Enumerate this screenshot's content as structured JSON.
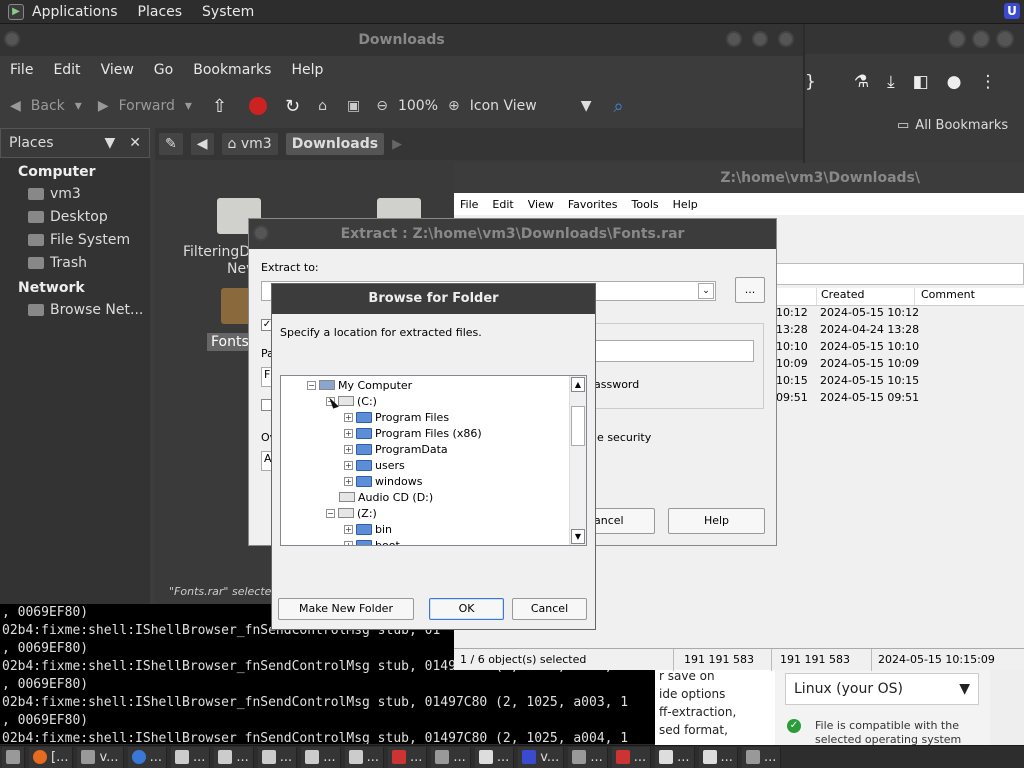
{
  "top_panel": {
    "applications": "Applications",
    "places": "Places",
    "system": "System"
  },
  "browser": {
    "bookmarks_label": "All Bookmarks"
  },
  "browser_page": {
    "lines": [
      "r save on",
      "ide options",
      "ff-extraction,",
      "sed format,"
    ],
    "os_select": "Linux (your OS)",
    "compat_text": "File is compatible with the",
    "compat_text2": "selected operating system"
  },
  "nautilus": {
    "title": "Downloads",
    "menu": [
      "File",
      "Edit",
      "View",
      "Go",
      "Bookmarks",
      "Help"
    ],
    "back": "Back",
    "forward": "Forward",
    "zoom": "100%",
    "view_mode": "Icon View",
    "places_header": "Places",
    "computer_section": "Computer",
    "computer_items": [
      "vm3",
      "Desktop",
      "File System",
      "Trash"
    ],
    "network_section": "Network",
    "network_items": [
      "Browse Net..."
    ],
    "path": [
      "vm3",
      "Downloads"
    ],
    "files": [
      "FilteringDi",
      "Nev",
      "Fonts"
    ],
    "status": "\"Fonts.rar\" selected ("
  },
  "terminal": {
    "lines": [
      ", 0069EF80)",
      "02b4:fixme:shell:IShellBrowser_fnSendControlMsg stub, 01",
      ", 0069EF80)",
      "02b4:fixme:shell:IShellBrowser_fnSendControlMsg stub, 01497C80 (2, 1025, a003, 1",
      ", 0069EF80)",
      "02b4:fixme:shell:IShellBrowser_fnSendControlMsg stub, 01497C80 (2, 1025, a003, 1",
      ", 0069EF80)",
      "02b4:fixme:shell:IShellBrowser_fnSendControlMsg stub, 01497C80 (2, 1025, a004, 1"
    ]
  },
  "sevenzip": {
    "title": "Z:\\home\\vm3\\Downloads\\",
    "menu": [
      "File",
      "Edit",
      "View",
      "Favorites",
      "Tools",
      "Help"
    ],
    "columns": [
      "Created",
      "Comment"
    ],
    "rows": [
      [
        "10:12",
        "2024-05-15 10:12"
      ],
      [
        "13:28",
        "2024-04-24 13:28"
      ],
      [
        "10:10",
        "2024-05-15 10:10"
      ],
      [
        "10:09",
        "2024-05-15 10:09"
      ],
      [
        "10:15",
        "2024-05-15 10:15"
      ],
      [
        "09:51",
        "2024-05-15 09:51"
      ]
    ],
    "status": [
      "1 / 6 object(s) selected",
      "191 191 583",
      "191 191 583",
      "2024-05-15 10:15:09"
    ]
  },
  "extract": {
    "title": "Extract : Z:\\home\\vm3\\Downloads\\Fonts.rar",
    "extract_to": "Extract to:",
    "browse_btn": "...",
    "password_frag": "assword",
    "security_frag": "le security",
    "cancel_frag": "ancel",
    "help": "Help",
    "side_letters": [
      "Pa",
      "F",
      "Ov",
      "A"
    ]
  },
  "browse": {
    "title": "Browse for Folder",
    "description": "Specify a location for extracted files.",
    "tree": [
      "My Computer",
      "(C:)",
      "Program Files",
      "Program Files (x86)",
      "ProgramData",
      "users",
      "windows",
      "Audio CD (D:)",
      "(Z:)",
      "bin",
      "boot"
    ],
    "make_new_folder": "Make New Folder",
    "ok": "OK",
    "cancel": "Cancel"
  },
  "taskbar": {
    "items": [
      "[...",
      "v...",
      "...",
      "...",
      "...",
      "...",
      "...",
      "...",
      "...",
      "...",
      "...",
      "v...",
      "...",
      "...",
      "...",
      "...",
      "..."
    ]
  }
}
